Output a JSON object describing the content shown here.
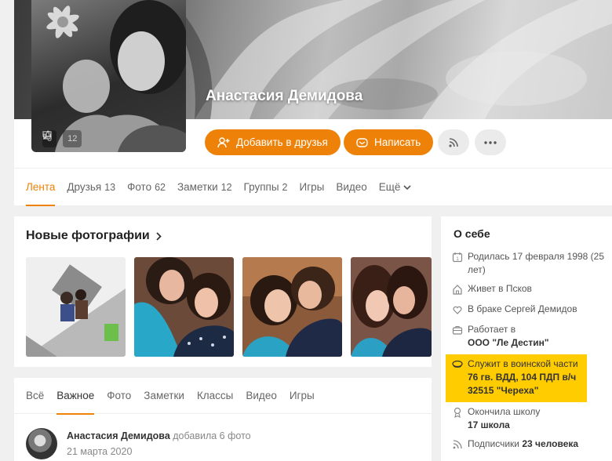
{
  "profile": {
    "name": "Анастасия Демидова",
    "avatar_stats": [
      {
        "icon": "comment-icon",
        "count": "0"
      },
      {
        "icon": "like-icon",
        "count": "12"
      }
    ]
  },
  "actions": {
    "add_friend": "Добавить в друзья",
    "message": "Написать",
    "subscribe_icon": "rss-icon",
    "more_icon": "more-dots-icon"
  },
  "tabs": [
    {
      "label": "Лента",
      "count": "",
      "active": true
    },
    {
      "label": "Друзья",
      "count": "13"
    },
    {
      "label": "Фото",
      "count": "62"
    },
    {
      "label": "Заметки",
      "count": "12"
    },
    {
      "label": "Группы",
      "count": "2"
    },
    {
      "label": "Игры",
      "count": ""
    },
    {
      "label": "Видео",
      "count": ""
    },
    {
      "label": "Ещё",
      "count": ""
    }
  ],
  "new_photos": {
    "title": "Новые фотографии"
  },
  "feed": {
    "tabs": [
      "Всё",
      "Важное",
      "Фото",
      "Заметки",
      "Классы",
      "Видео",
      "Игры"
    ],
    "active_tab": "Важное",
    "post": {
      "author": "Анастасия Демидова",
      "action": "добавила 6 фото",
      "date": "21 марта 2020"
    }
  },
  "about": {
    "title": "О себе",
    "born": "Родилась 17 февраля 1998 (25 лет)",
    "lives": "Живет в Псков",
    "married": "В браке Сергей Демидов",
    "works_prefix": "Работает в",
    "works_place": "ООО \"Ле Дестин\"",
    "serves_prefix": "Служит в воинской части",
    "serves_unit": "76 гв. ВДД, 104 ПДП в/ч 32515 \"Череха\"",
    "school_prefix": "Окончила школу",
    "school_name": "17 школа",
    "subscribers_prefix": "Подписчики",
    "subscribers_count": "23 человека"
  },
  "colors": {
    "accent": "#ee8208",
    "highlight": "#ffcc00"
  }
}
